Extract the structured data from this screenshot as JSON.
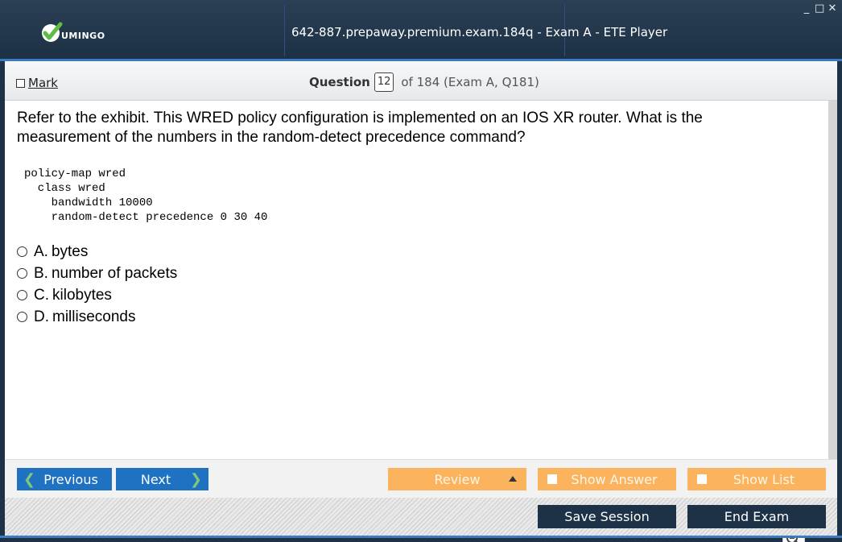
{
  "window": {
    "title": "642-887.prepaway.premium.exam.184q - Exam A - ETE Player",
    "controls": [
      "_",
      "□",
      "✕"
    ]
  },
  "logo": {
    "text": "UMINGO",
    "check_color": "#5dbb46"
  },
  "header": {
    "mark_label": "Mark",
    "question_label": "Question",
    "question_number": "12",
    "question_of": "of 184 (Exam A, Q181)"
  },
  "question": {
    "text": "Refer to the exhibit. This WRED policy configuration is implemented on an IOS XR router. What is the measurement of the numbers in the random-detect precedence command?",
    "exhibit": "policy-map wred\n  class wred\n    bandwidth 10000\n    random-detect precedence 0 30 40",
    "options": [
      {
        "letter": "A.",
        "text": "bytes"
      },
      {
        "letter": "B.",
        "text": "number of packets"
      },
      {
        "letter": "C.",
        "text": "kilobytes"
      },
      {
        "letter": "D.",
        "text": "milliseconds"
      }
    ]
  },
  "zoom": {
    "icons": [
      "search-icon",
      "zoom-in-icon",
      "zoom-out-icon"
    ]
  },
  "nav": {
    "previous_label": "Previous",
    "next_label": "Next",
    "review_label": "Review",
    "show_answer_label": "Show Answer",
    "show_list_label": "Show List",
    "save_session_label": "Save Session",
    "end_exam_label": "End Exam"
  },
  "colors": {
    "titlebar": "#1d3247",
    "accent_blue": "#1f72c2",
    "accent_orange": "#fbb35e",
    "dark_button": "#1d3247"
  }
}
